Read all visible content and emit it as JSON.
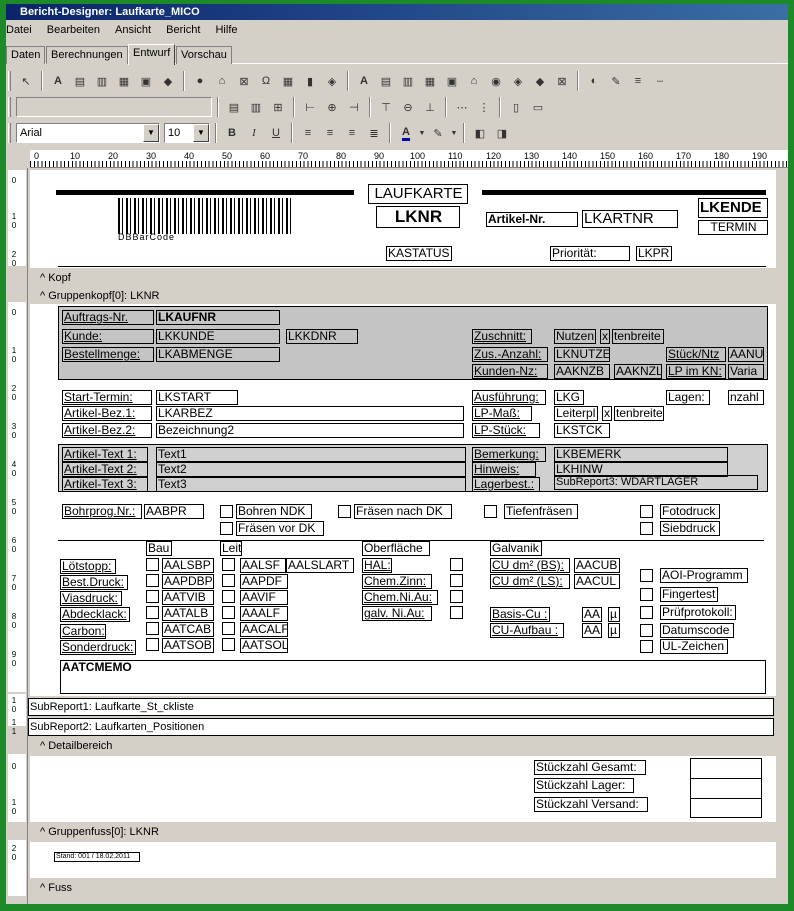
{
  "window": {
    "title": "Bericht-Designer: Laufkarte_MICO"
  },
  "menu": [
    "Datei",
    "Bearbeiten",
    "Ansicht",
    "Bericht",
    "Hilfe"
  ],
  "tabs": [
    "Daten",
    "Berechnungen",
    "Entwurf",
    "Vorschau"
  ],
  "format": {
    "font": "Arial",
    "size": "10"
  },
  "ruler": [
    "0",
    "10",
    "20",
    "30",
    "40",
    "50",
    "60",
    "70",
    "80",
    "90",
    "100",
    "110",
    "120",
    "130",
    "140",
    "150",
    "160",
    "170",
    "180",
    "190"
  ],
  "bands": {
    "kopf": "Kopf",
    "gruppenkopf": "Gruppenkopf[0]: LKNR",
    "detail": "Detailbereich",
    "gruppenfuss": "Gruppenfuss[0]: LKNR",
    "fuss": "Fuss"
  },
  "kopf": {
    "laufkarte": "LAUFKARTE",
    "lknr": "LKNR",
    "barcode": "DBBarCode",
    "artikelnr_label": "Artikel-Nr.",
    "lkartnr": "LKARTNR",
    "lkende": "LKENDE",
    "termin": "TERMIN",
    "kastatus": "KASTATUS",
    "prioritaet": "Priorität:",
    "lkpr": "LKPR"
  },
  "gk": {
    "auftrags_label": "Auftrags-Nr.",
    "lkaufnr": "LKAUFNR",
    "kunde_label": "Kunde:",
    "lkkunde": "LKKUNDE",
    "lkkdnr": "LKKDNR",
    "bestellmenge_label": "Bestellmenge:",
    "lkabmenge": "LKABMENGE",
    "zuschnitt": "Zuschnitt:",
    "nutzen": "Nutzen",
    "x1": "x",
    "tenbreite1": "tenbreite",
    "zusanzahl": "Zus.-Anzahl:",
    "lknutze": "LKNUTZE",
    "stueckntz": "Stück/Ntz",
    "aanu": "AANU",
    "kundennz": "Kunden-Nz:",
    "aaknzb": "AAKNZB",
    "aaknzl": "AAKNZL",
    "lpimkn": "LP im KN:",
    "varia": "Varia",
    "starttermin": "Start-Termin:",
    "lkstart": "LKSTART",
    "ausfuehrung": "Ausführung:",
    "lkg": "LKG",
    "lagen": "Lagen:",
    "nzahl": "nzahl",
    "artbez1": "Artikel-Bez.1:",
    "lkarbez": "LKARBEZ",
    "lpmass": "LP-Maß:",
    "leiterpl": "Leiterpl",
    "x2": "x",
    "tenbreite2": "tenbreite",
    "artbez2": "Artikel-Bez.2:",
    "bezeichnung2": "Bezeichnung2",
    "lpstueck": "LP-Stück:",
    "lkstck": "LKSTCK",
    "arttext1": "Artikel-Text 1:",
    "text1": "Text1",
    "bemerkung": "Bemerkung:",
    "lkbemerk": "LKBEMERK",
    "arttext2": "Artikel-Text 2:",
    "text2": "Text2",
    "hinweis": "Hinweis:",
    "lkhinw": "LKHINW",
    "arttext3": "Artikel-Text 3:",
    "text3": "Text3",
    "lagerbest": "Lagerbest.:",
    "subreport3": "SubReport3: WDARTLAGER",
    "bohrprog": "Bohrprog.Nr.:",
    "aabpr": "AABPR",
    "bohrenndk": "Bohren NDK",
    "fraesennachdk": "Fräsen nach DK",
    "tiefenfraesen": "Tiefenfräsen",
    "fotodruck": "Fotodruck",
    "fraesenvordk": "Fräsen vor DK",
    "siebdruck": "Siebdruck",
    "bau": "Bau",
    "leit": "Leit",
    "oberflaeche": "Oberfläche",
    "galvanik": "Galvanik",
    "loetstopp": "Lötstopp:",
    "bestdruck": "Best.Druck:",
    "viasdruck": "Viasdruck:",
    "abdecklack": "Abdecklack:",
    "carbon": "Carbon:",
    "sonderdruck": "Sonderdruck:",
    "aalsbp": "AALSBP",
    "aapdbp": "AAPDBP",
    "aatvib": "AATVIB",
    "aatalb": "AATALB",
    "aatcab": "AATCAB",
    "aatsob": "AATSOB",
    "aalsf": "AALSF",
    "aalslart": "AALSLART",
    "aapdf": "AAPDF",
    "aavif": "AAVIF",
    "aaalf": "AAALF",
    "aacalf": "AACALF",
    "aatsol": "AATSOL",
    "hal": "HAL:",
    "chemzinn": "Chem.Zinn:",
    "chemniau": "Chem.Ni.Au:",
    "galvniau": "galv. Ni.Au:",
    "cubs": "CU dm² (BS):",
    "aacub": "AACUB",
    "culs": "CU dm² (LS):",
    "aacul": "AACUL",
    "basiscu": "Basis-Cu :",
    "cuaufbau": "CU-Aufbau :",
    "aa1": "AA",
    "mu1": "µ",
    "aa2": "AA",
    "mu2": "µ",
    "aoi": "AOI-Programm",
    "fingertest": "Fingertest",
    "pruefprotokoll": "Prüfprotokoll:",
    "datumscode": "Datumscode",
    "ulzeichen": "UL-Zeichen",
    "aatcmemo": "AATCMEMO"
  },
  "subreports": [
    "SubReport1: Laufkarte_St_ckliste",
    "SubReport2: Laufkarten_Positionen"
  ],
  "detail": {
    "gesamt": "Stückzahl Gesamt:",
    "lager": "Stückzahl Lager:",
    "versand": "Stückzahl Versand:"
  },
  "footer": {
    "stand": "Stand: 001 / 18.02.2011"
  },
  "vruler_labels": [
    "0",
    "1 0",
    "2 0",
    "0",
    "1 0",
    "2 0",
    "3 0",
    "4 0",
    "5 0",
    "6 0",
    "7 0",
    "8 0",
    "9 0",
    "1 0",
    "1 1",
    "0",
    "1 0",
    "2 0",
    "0"
  ]
}
